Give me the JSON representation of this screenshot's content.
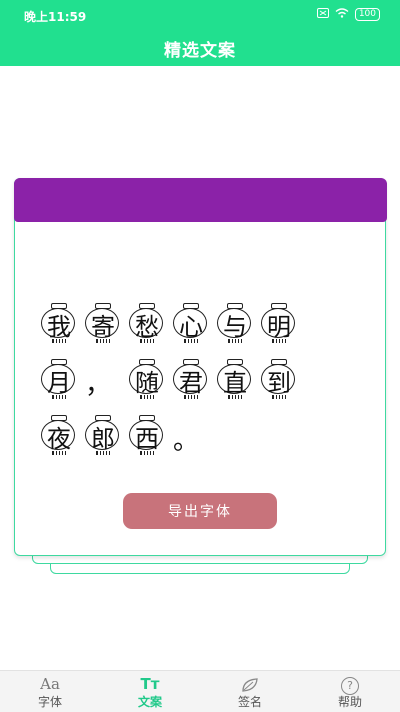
{
  "status_bar": {
    "time": "晚上11:59",
    "battery": "100"
  },
  "header": {
    "title": "精选文案"
  },
  "card": {
    "header_color": "#8b22a8",
    "glyphs": [
      {
        "char": "我",
        "type": "glyph"
      },
      {
        "char": "寄",
        "type": "glyph"
      },
      {
        "char": "愁",
        "type": "glyph"
      },
      {
        "char": "心",
        "type": "glyph"
      },
      {
        "char": "与",
        "type": "glyph"
      },
      {
        "char": "明",
        "type": "glyph"
      },
      {
        "char": "月",
        "type": "glyph"
      },
      {
        "char": "，",
        "type": "punct"
      },
      {
        "char": "随",
        "type": "glyph"
      },
      {
        "char": "君",
        "type": "glyph"
      },
      {
        "char": "直",
        "type": "glyph"
      },
      {
        "char": "到",
        "type": "glyph"
      },
      {
        "char": "夜",
        "type": "glyph"
      },
      {
        "char": "郎",
        "type": "glyph"
      },
      {
        "char": "西",
        "type": "glyph"
      },
      {
        "char": "。",
        "type": "punct"
      }
    ],
    "export_label": "导出字体"
  },
  "nav": {
    "items": [
      {
        "label": "字体",
        "icon": "Aa"
      },
      {
        "label": "文案",
        "icon": "Tт"
      },
      {
        "label": "签名",
        "icon": "leaf-icon"
      },
      {
        "label": "帮助",
        "icon": "?"
      }
    ]
  },
  "colors": {
    "accent": "#21e08f",
    "button": "#c8737b",
    "border": "#3ed9a0"
  }
}
